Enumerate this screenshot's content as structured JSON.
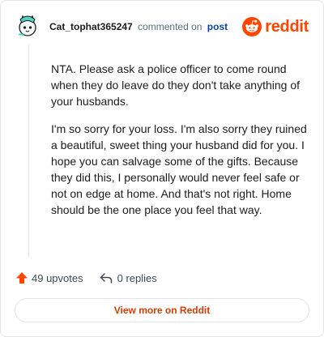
{
  "comment": {
    "author": "Cat_tophat365247",
    "commented_text": "commented on",
    "post_link": "post",
    "paragraphs": [
      "NTA. Please ask a police officer to come round when they do leave do they don't take anything of your husbands.",
      "I'm so sorry for your loss. I'm also sorry they ruined a beautiful, sweet thing your husband did for you. I hope you can salvage some of the gifts. Because they did this, I personally would never feel safe or not on edge at home. And that's not right. Home should be the one place you feel that way."
    ]
  },
  "brand": {
    "text": "reddit",
    "color": "#ff4500",
    "icon": "reddit-logo-icon"
  },
  "actions": {
    "upvotes": "49 upvotes",
    "upvote_icon": "upvote-arrow-icon",
    "upvote_color": "#ff4500",
    "replies": "0 replies",
    "reply_icon": "reply-arrow-icon"
  },
  "footer": {
    "view_more": "View more on Reddit",
    "view_more_color": "#d93a00"
  },
  "avatar": {
    "icon": "cat-avatar-icon",
    "accent": "#4fd1c5"
  }
}
